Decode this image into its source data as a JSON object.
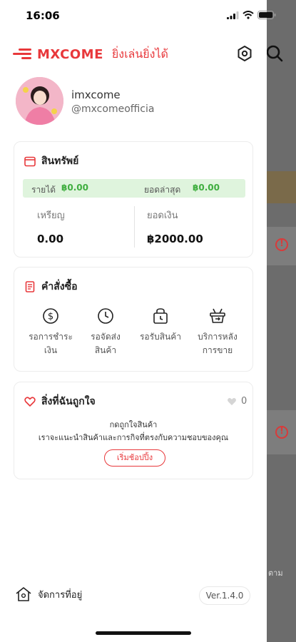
{
  "status_bar": {
    "time": "16:06"
  },
  "brand": {
    "logo_text": "MXCOME",
    "slogan": "ยิ่งเล่นยิ่งได้",
    "accent_color": "#e8383b"
  },
  "profile": {
    "username": "imxcome",
    "handle": "@mxcomeofficia"
  },
  "wallet": {
    "title": "สินทรัพย์",
    "income_label": "รายได้",
    "income_value": "฿0.00",
    "latest_label": "ยอดล่าสุด",
    "latest_value": "฿0.00",
    "coins_label": "เหรียญ",
    "coins_value": "0.00",
    "balance_label": "ยอดเงิน",
    "balance_value": "฿2000.00"
  },
  "orders": {
    "title": "คำสั่งซื้อ",
    "items": [
      {
        "label": "รอการชำระเงิน",
        "line1": "รอการชำระ",
        "line2": "เงิน",
        "icon": "dollar-circle-icon"
      },
      {
        "label": "รอจัดส่งสินค้า",
        "line1": "รอจัดส่ง",
        "line2": "สินค้า",
        "icon": "clock-icon"
      },
      {
        "label": "รอรับสินค้า",
        "line1": "รอรับสินค้า",
        "line2": "",
        "icon": "package-clock-icon"
      },
      {
        "label": "บริการหลังการขาย",
        "line1": "บริการหลัง",
        "line2": "การขาย",
        "icon": "basket-return-icon"
      }
    ]
  },
  "wishlist": {
    "title": "สิ่งที่ฉันถูกใจ",
    "count": "0",
    "empty_line1": "กดถูกใจสินค้า",
    "empty_line2": "เราจะแนะนำสินค้าและการกิจที่ตรงกับความชอบของคุณ",
    "shop_button": "เริ่มช้อปปิ้ง"
  },
  "footer": {
    "address_label": "จัดการที่อยู่",
    "version": "Ver.1.4.0"
  },
  "background": {
    "partial_text": "ตาม"
  }
}
